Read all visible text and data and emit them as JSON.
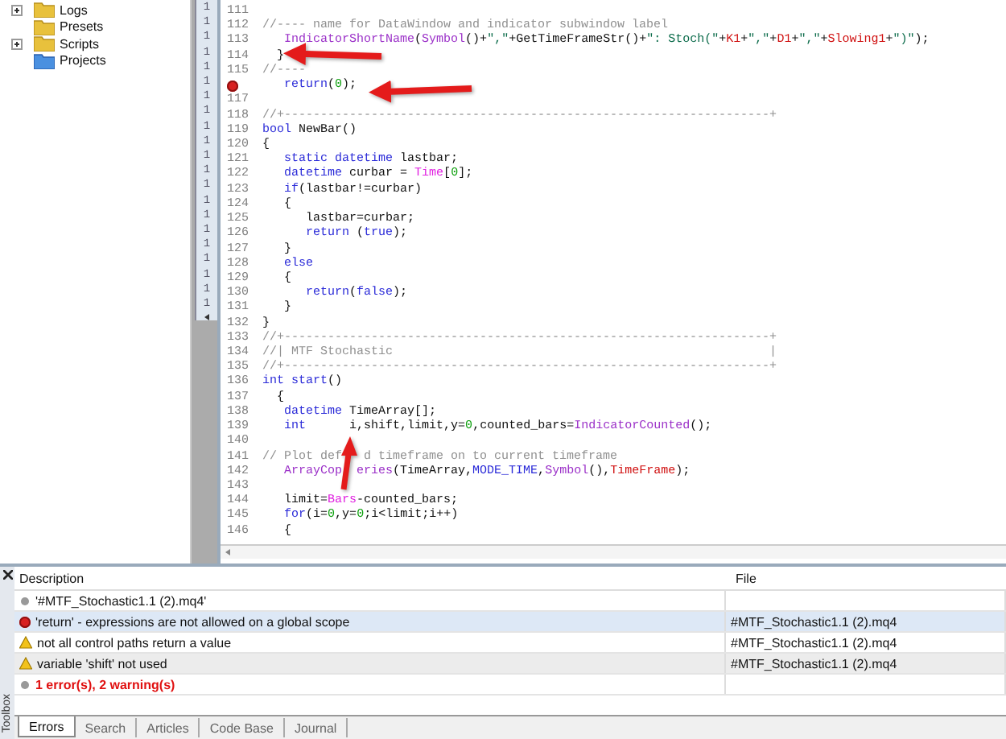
{
  "navigator": {
    "items": [
      {
        "label": "Logs",
        "kind": "folder",
        "expanded": false
      },
      {
        "label": "Presets",
        "kind": "folder"
      },
      {
        "label": "Scripts",
        "kind": "folder",
        "expanded": false
      },
      {
        "label": "Projects",
        "kind": "project"
      }
    ]
  },
  "background_window": {
    "line_numbers": [
      "1",
      "1",
      "1",
      "1",
      "1",
      "1",
      "1",
      "1",
      "1",
      "1",
      "1",
      "1",
      "1",
      "1",
      "1",
      "1",
      "1",
      "1",
      "1",
      "1",
      "1"
    ]
  },
  "editor": {
    "lines": [
      {
        "number": "111"
      },
      {
        "number": "112",
        "tokens": [
          {
            "kind": "comment",
            "text": "//---- name for DataWindow and indicator subwindow label"
          }
        ]
      },
      {
        "number": "113",
        "tokens": [
          {
            "kind": "function",
            "text": "   IndicatorShortName"
          },
          {
            "kind": "plain",
            "text": "("
          },
          {
            "kind": "function",
            "text": "Symbol"
          },
          {
            "kind": "plain",
            "text": "()+"
          },
          {
            "kind": "string",
            "text": "\",\""
          },
          {
            "kind": "plain",
            "text": "+GetTimeFrameStr()+"
          },
          {
            "kind": "string",
            "text": "\": Stoch(\""
          },
          {
            "kind": "plain",
            "text": "+"
          },
          {
            "kind": "variable",
            "text": "K1"
          },
          {
            "kind": "plain",
            "text": "+"
          },
          {
            "kind": "string",
            "text": "\",\""
          },
          {
            "kind": "plain",
            "text": "+"
          },
          {
            "kind": "variable",
            "text": "D1"
          },
          {
            "kind": "plain",
            "text": "+"
          },
          {
            "kind": "string",
            "text": "\",\""
          },
          {
            "kind": "plain",
            "text": "+"
          },
          {
            "kind": "variable",
            "text": "Slowing1"
          },
          {
            "kind": "plain",
            "text": "+"
          },
          {
            "kind": "string",
            "text": "\")\""
          },
          {
            "kind": "plain",
            "text": ");"
          }
        ]
      },
      {
        "number": "114",
        "tokens": [
          {
            "kind": "plain",
            "text": "  }"
          }
        ]
      },
      {
        "number": "115",
        "tokens": [
          {
            "kind": "comment",
            "text": "//----"
          }
        ]
      },
      {
        "error": true,
        "tokens": [
          {
            "kind": "keyword",
            "text": "   return"
          },
          {
            "kind": "plain",
            "text": "("
          },
          {
            "kind": "number",
            "text": "0"
          },
          {
            "kind": "plain",
            "text": ");"
          }
        ]
      },
      {
        "number": "117"
      },
      {
        "number": "118",
        "tokens": [
          {
            "kind": "comment",
            "text": "//+-------------------------------------------------------------------+"
          }
        ]
      },
      {
        "number": "119",
        "tokens": [
          {
            "kind": "keyword",
            "text": "bool"
          },
          {
            "kind": "plain",
            "text": " NewBar()"
          }
        ]
      },
      {
        "number": "120",
        "tokens": [
          {
            "kind": "plain",
            "text": "{"
          }
        ]
      },
      {
        "number": "121",
        "tokens": [
          {
            "kind": "keyword",
            "text": "   static datetime"
          },
          {
            "kind": "plain",
            "text": " lastbar;"
          }
        ]
      },
      {
        "number": "122",
        "tokens": [
          {
            "kind": "keyword",
            "text": "   datetime"
          },
          {
            "kind": "plain",
            "text": " curbar = "
          },
          {
            "kind": "system",
            "text": "Time"
          },
          {
            "kind": "plain",
            "text": "["
          },
          {
            "kind": "number",
            "text": "0"
          },
          {
            "kind": "plain",
            "text": "];"
          }
        ]
      },
      {
        "number": "123",
        "tokens": [
          {
            "kind": "keyword",
            "text": "   if"
          },
          {
            "kind": "plain",
            "text": "(lastbar!=curbar)"
          }
        ]
      },
      {
        "number": "124",
        "tokens": [
          {
            "kind": "plain",
            "text": "   {"
          }
        ]
      },
      {
        "number": "125",
        "tokens": [
          {
            "kind": "plain",
            "text": "      lastbar=curbar;"
          }
        ]
      },
      {
        "number": "126",
        "tokens": [
          {
            "kind": "keyword",
            "text": "      return"
          },
          {
            "kind": "plain",
            "text": " ("
          },
          {
            "kind": "keyword",
            "text": "true"
          },
          {
            "kind": "plain",
            "text": ");"
          }
        ]
      },
      {
        "number": "127",
        "tokens": [
          {
            "kind": "plain",
            "text": "   }"
          }
        ]
      },
      {
        "number": "128",
        "tokens": [
          {
            "kind": "keyword",
            "text": "   else"
          }
        ]
      },
      {
        "number": "129",
        "tokens": [
          {
            "kind": "plain",
            "text": "   {"
          }
        ]
      },
      {
        "number": "130",
        "tokens": [
          {
            "kind": "keyword",
            "text": "      return"
          },
          {
            "kind": "plain",
            "text": "("
          },
          {
            "kind": "keyword",
            "text": "false"
          },
          {
            "kind": "plain",
            "text": ");"
          }
        ]
      },
      {
        "number": "131",
        "tokens": [
          {
            "kind": "plain",
            "text": "   }"
          }
        ]
      },
      {
        "number": "132",
        "tokens": [
          {
            "kind": "plain",
            "text": "}"
          }
        ]
      },
      {
        "number": "133",
        "tokens": [
          {
            "kind": "comment",
            "text": "//+-------------------------------------------------------------------+"
          }
        ]
      },
      {
        "number": "134",
        "tokens": [
          {
            "kind": "comment",
            "text": "//| MTF Stochastic                                                    |"
          }
        ]
      },
      {
        "number": "135",
        "tokens": [
          {
            "kind": "comment",
            "text": "//+-------------------------------------------------------------------+"
          }
        ]
      },
      {
        "number": "136",
        "tokens": [
          {
            "kind": "keyword",
            "text": "int start"
          },
          {
            "kind": "plain",
            "text": "()"
          }
        ]
      },
      {
        "number": "137",
        "tokens": [
          {
            "kind": "plain",
            "text": "  {"
          }
        ]
      },
      {
        "number": "138",
        "tokens": [
          {
            "kind": "keyword",
            "text": "   datetime"
          },
          {
            "kind": "plain",
            "text": " TimeArray[];"
          }
        ]
      },
      {
        "number": "139",
        "tokens": [
          {
            "kind": "keyword",
            "text": "   int"
          },
          {
            "kind": "plain",
            "text": "      i,shift,limit,y="
          },
          {
            "kind": "number",
            "text": "0"
          },
          {
            "kind": "plain",
            "text": ",counted_bars="
          },
          {
            "kind": "function",
            "text": "IndicatorCounted"
          },
          {
            "kind": "plain",
            "text": "();"
          }
        ]
      },
      {
        "number": "140"
      },
      {
        "number": "141",
        "tokens": [
          {
            "kind": "comment",
            "text": "// Plot def   d timeframe on to current timeframe"
          }
        ]
      },
      {
        "number": "142",
        "tokens": [
          {
            "kind": "function",
            "text": "   ArrayCop  eries"
          },
          {
            "kind": "plain",
            "text": "(TimeArray,"
          },
          {
            "kind": "keyword",
            "text": "MODE_TIME"
          },
          {
            "kind": "plain",
            "text": ","
          },
          {
            "kind": "function",
            "text": "Symbol"
          },
          {
            "kind": "plain",
            "text": "(),"
          },
          {
            "kind": "variable",
            "text": "TimeFrame"
          },
          {
            "kind": "plain",
            "text": ");"
          }
        ]
      },
      {
        "number": "143"
      },
      {
        "number": "144",
        "tokens": [
          {
            "kind": "plain",
            "text": "   limit="
          },
          {
            "kind": "system",
            "text": "Bars"
          },
          {
            "kind": "plain",
            "text": "-counted_bars;"
          }
        ]
      },
      {
        "number": "145",
        "tokens": [
          {
            "kind": "keyword",
            "text": "   for"
          },
          {
            "kind": "plain",
            "text": "(i="
          },
          {
            "kind": "number",
            "text": "0"
          },
          {
            "kind": "plain",
            "text": ",y="
          },
          {
            "kind": "number",
            "text": "0"
          },
          {
            "kind": "plain",
            "text": ";i<limit;i++)"
          }
        ]
      },
      {
        "number": "146",
        "tokens": [
          {
            "kind": "plain",
            "text": "   {"
          }
        ]
      }
    ]
  },
  "toolbox": {
    "title": "Toolbox",
    "columns": [
      "Description",
      "File"
    ],
    "rows": [
      {
        "kind": "file",
        "description": "'#MTF_Stochastic1.1 (2).mq4'",
        "selected": false
      },
      {
        "kind": "error",
        "description": "'return' - expressions are not allowed on a global scope",
        "file": "#MTF_Stochastic1.1 (2).mq4",
        "selected": true
      },
      {
        "kind": "warning",
        "description": "not all control paths return a value",
        "file": "#MTF_Stochastic1.1 (2).mq4",
        "selected": false
      },
      {
        "kind": "warning",
        "description": "variable 'shift' not used",
        "file": "#MTF_Stochastic1.1 (2).mq4",
        "selected": false
      },
      {
        "kind": "summary",
        "description": "1 error(s), 2 warning(s)",
        "selected": false
      }
    ],
    "tabs": [
      {
        "label": "Errors",
        "selected": true
      },
      {
        "label": "Search",
        "selected": false
      },
      {
        "label": "Articles",
        "selected": false
      },
      {
        "label": "Code Base",
        "selected": false
      },
      {
        "label": "Journal",
        "selected": false
      }
    ]
  }
}
